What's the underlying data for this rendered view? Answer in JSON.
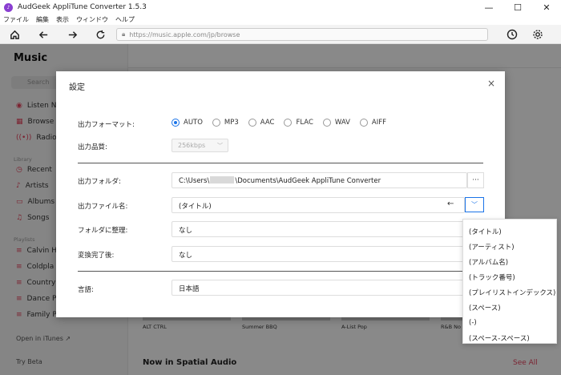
{
  "window": {
    "title": "AudGeek AppliTune Converter 1.5.3",
    "minimize": "—",
    "maximize": "☐",
    "close": "✕"
  },
  "menubar": [
    "ファイル",
    "編集",
    "表示",
    "ウィンドウ",
    "ヘルプ"
  ],
  "toolbar": {
    "url": "https://music.apple.com/jp/browse"
  },
  "background": {
    "logo": "Music",
    "search_placeholder": "Search",
    "nav": [
      "Listen N",
      "Browse",
      "Radio"
    ],
    "library_section": "Library",
    "library": [
      "Recent",
      "Artists",
      "Albums",
      "Songs"
    ],
    "playlists_section": "Playlists",
    "playlists": [
      "Calvin H",
      "Coldpla",
      "Country",
      "Dance P",
      "Family P"
    ],
    "open_itunes": "Open in iTunes ↗",
    "try_beta": "Try Beta",
    "spatial_title": "Now in Spatial Audio",
    "see_all": "See All",
    "tile_labels": [
      "ALT CTRL",
      "Summer BBQ",
      "A-List Pop",
      "R&B No"
    ]
  },
  "dialog": {
    "title": "設定",
    "close": "×",
    "output_format_label": "出力フォーマット:",
    "formats": [
      "AUTO",
      "MP3",
      "AAC",
      "FLAC",
      "WAV",
      "AIFF"
    ],
    "selected_format": "AUTO",
    "quality_label": "出力品質:",
    "quality_value": "256kbps",
    "output_folder_label": "出力フォルダ:",
    "output_folder_prefix": "C:\\Users\\",
    "output_folder_suffix": "\\Documents\\AudGeek AppliTune Converter",
    "browse_button": "···",
    "filename_label": "出力ファイル名:",
    "filename_value": "(タイトル)",
    "organize_label": "フォルダに整理:",
    "organize_value": "なし",
    "after_convert_label": "変換完了後:",
    "after_convert_value": "なし",
    "language_label": "言語:",
    "language_value": "日本語"
  },
  "dropdown": {
    "items": [
      "(タイトル)",
      "(アーティスト)",
      "(アルバム名)",
      "(トラック番号)",
      "(プレイリストインデックス)",
      "(スペース)",
      "(-)",
      "(スペース-スペース)"
    ]
  }
}
